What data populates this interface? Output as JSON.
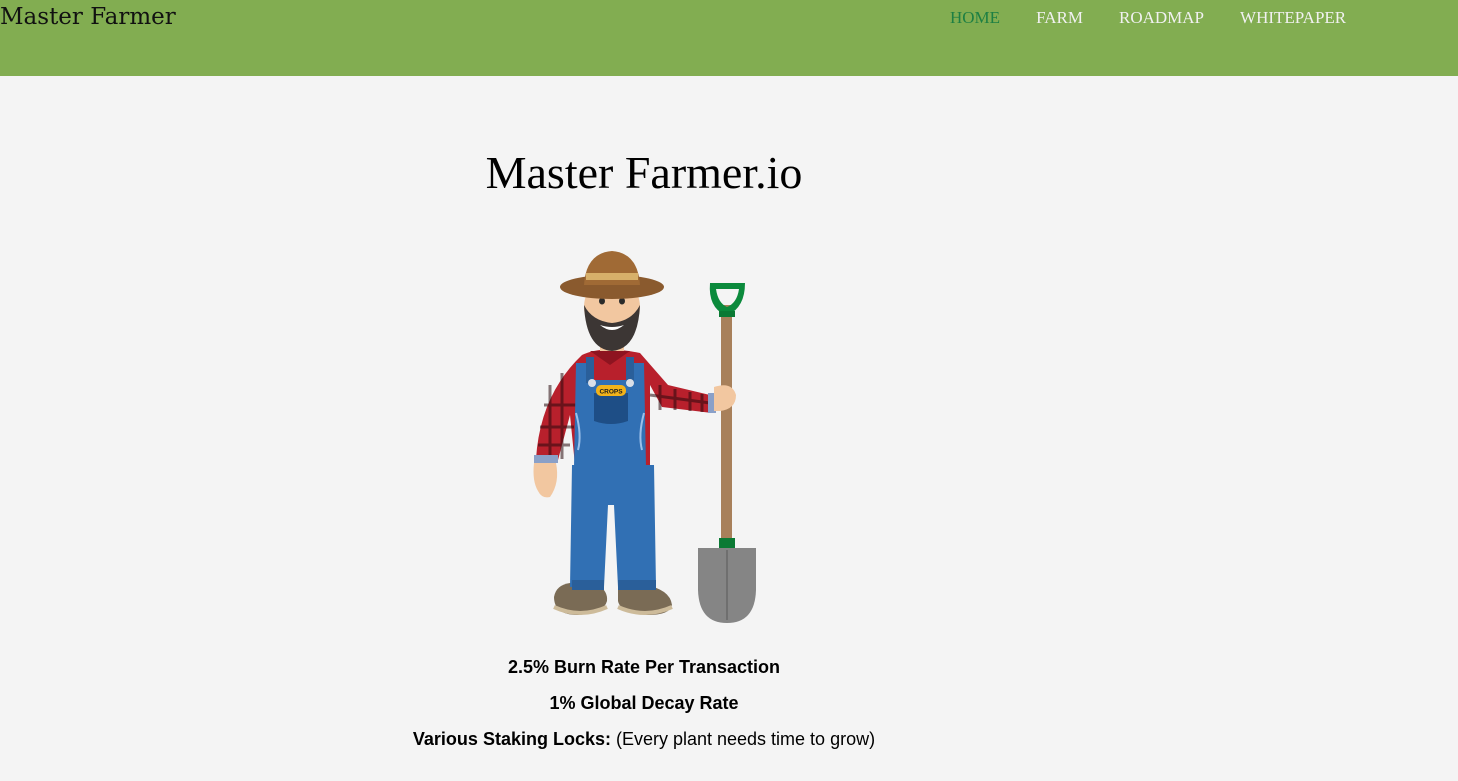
{
  "navbar": {
    "brand": "Master Farmer",
    "links": [
      {
        "label": "HOME",
        "active": true
      },
      {
        "label": "FARM",
        "active": false
      },
      {
        "label": "ROADMAP",
        "active": false
      },
      {
        "label": "WHITEPAPER",
        "active": false
      }
    ],
    "background_color": "#82ad51",
    "active_color": "#1d7f43"
  },
  "hero": {
    "title": "Master Farmer.io",
    "illustration": {
      "name": "farmer-with-shovel-illustration",
      "pocket_badge_text": "CROPS"
    }
  },
  "features": [
    {
      "bold": "2.5% Burn Rate Per Transaction",
      "text": ""
    },
    {
      "bold": "1% Global Decay Rate",
      "text": ""
    },
    {
      "bold": "Various Staking Locks:",
      "text": " (Every plant needs time to grow)"
    }
  ]
}
